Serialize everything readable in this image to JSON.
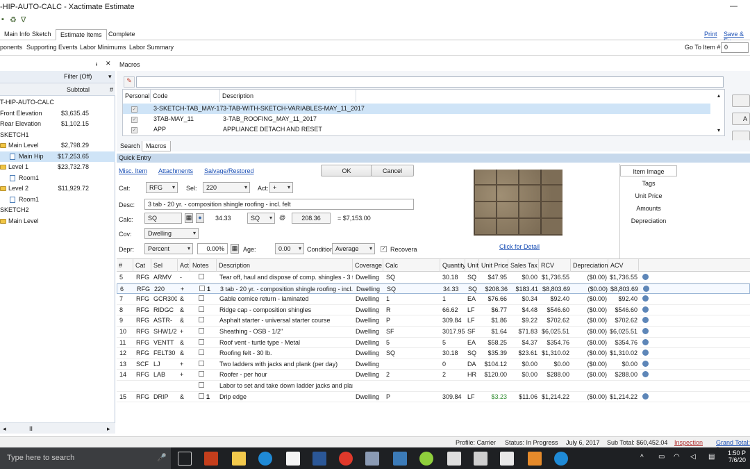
{
  "window": {
    "title": "-HIP-AUTO-CALC - Xactimate Estimate"
  },
  "tabs": [
    {
      "label": "Main Info"
    },
    {
      "label": "Sketch"
    },
    {
      "label": "Estimate Items"
    },
    {
      "label": "Complete"
    }
  ],
  "top_links": {
    "print": "Print",
    "save_exit": "Save & Ex"
  },
  "subribbon": {
    "items": [
      "ponents",
      "Supporting Events",
      "Labor Minimums",
      "Labor Summary"
    ],
    "goto_label": "Go To Item #:",
    "goto_value": "0"
  },
  "left_panel": {
    "filter": "Filter (Off)",
    "subtotal_header": "Subtotal",
    "hash_header": "#",
    "tree": [
      {
        "label": "T-HIP-AUTO-CALC",
        "value": ""
      },
      {
        "label": "Front Elevation",
        "value": "$3,635.45"
      },
      {
        "label": "Rear Elevation",
        "value": "$1,102.15"
      },
      {
        "label": "SKETCH1",
        "value": ""
      },
      {
        "label": "Main Level",
        "value": "$2,798.29"
      },
      {
        "label": "Main Hip",
        "value": "$17,253.65"
      },
      {
        "label": "Level 1",
        "value": "$23,732.78"
      },
      {
        "label": "Room1",
        "value": ""
      },
      {
        "label": "Level 2",
        "value": "$11,929.72"
      },
      {
        "label": "Room1",
        "value": ""
      },
      {
        "label": "SKETCH2",
        "value": ""
      },
      {
        "label": "Main Level",
        "value": ""
      }
    ],
    "scroll_label": "II"
  },
  "macros": {
    "title": "Macros",
    "columns": [
      "Personal",
      "Code",
      "Description"
    ],
    "rows": [
      {
        "code": "3-SKETCH-TAB_MAY-17",
        "description": "3-TAB-WITH-SKETCH-VARIABLES-MAY_11_2017"
      },
      {
        "code": "3TAB-MAY_11",
        "description": "3-TAB_ROOFING_MAY_11_2017"
      },
      {
        "code": "APP",
        "description": "APPLIANCE DETACH AND RESET"
      }
    ],
    "tabs": [
      "Search",
      "Macros"
    ],
    "side_buttons": [
      "A"
    ]
  },
  "quick_entry": {
    "bar_label": "Quick Entry",
    "links": {
      "misc": "Misc. Item",
      "attachments": "Attachments",
      "salvage": "Salvage/Restored"
    },
    "ok": "OK",
    "cancel": "Cancel",
    "cat_label": "Cat:",
    "cat_value": "RFG",
    "sel_label": "Sel:",
    "sel_value": "220",
    "act_label": "Act:",
    "act_value": "+",
    "desc_label": "Desc:",
    "desc_value": "3 tab - 20 yr. - composition shingle roofing - incl. felt",
    "calc_label": "Calc:",
    "calc_value": "SQ",
    "calc_qty": "34.33",
    "unit_value": "SQ",
    "at": "@",
    "unit_price": "208.36",
    "total": "= $7,153.00",
    "cov_label": "Cov:",
    "cov_value": "Dwelling",
    "depr_label": "Depr:",
    "depr_value": "Percent",
    "depr_pct": "0.00%",
    "age_label": "Age:",
    "age_value": "0.00",
    "condition_label": "Condition:",
    "condition_value": "Average",
    "recoverable_label": "Recovera",
    "detail_link": "Click for Detail",
    "side_tabs": [
      "Item Image",
      "Tags",
      "Unit Price",
      "Amounts",
      "Depreciation"
    ]
  },
  "grid": {
    "columns": [
      "#",
      "Cat",
      "Sel",
      "Act",
      "Notes",
      "Description",
      "Coverage",
      "Calc",
      "Quantity",
      "Unit",
      "Unit Price",
      "Sales Tax",
      "RCV",
      "Depreciation",
      "ACV"
    ],
    "rows": [
      {
        "n": "5",
        "cat": "RFG",
        "sel": "ARMV",
        "act": "-",
        "note": "",
        "desc": "Tear off, haul and dispose of comp. shingles - 3 tab",
        "cov": "Dwelling",
        "calc": "SQ",
        "qty": "30.18",
        "unit": "SQ",
        "price": "$47.95",
        "tax": "$0.00",
        "rcv": "$1,736.55",
        "dep": "($0.00)",
        "acv": "$1,736.55"
      },
      {
        "n": "6",
        "cat": "RFG",
        "sel": "220",
        "act": "+",
        "note": "1",
        "desc": "3 tab - 20 yr. - composition shingle roofing - incl. felt",
        "cov": "Dwelling",
        "calc": "SQ",
        "qty": "34.33",
        "unit": "SQ",
        "price": "$208.36",
        "tax": "$183.41",
        "rcv": "$8,803.69",
        "dep": "($0.00)",
        "acv": "$8,803.69"
      },
      {
        "n": "7",
        "cat": "RFG",
        "sel": "GCR300",
        "act": "&",
        "note": "",
        "desc": "Gable cornice return - laminated",
        "cov": "Dwelling",
        "calc": "1",
        "qty": "1",
        "unit": "EA",
        "price": "$76.66",
        "tax": "$0.34",
        "rcv": "$92.40",
        "dep": "($0.00)",
        "acv": "$92.40"
      },
      {
        "n": "8",
        "cat": "RFG",
        "sel": "RIDGC",
        "act": "&",
        "note": "",
        "desc": "Ridge cap - composition shingles",
        "cov": "Dwelling",
        "calc": "R",
        "qty": "66.62",
        "unit": "LF",
        "price": "$6.77",
        "tax": "$4.48",
        "rcv": "$546.60",
        "dep": "($0.00)",
        "acv": "$546.60"
      },
      {
        "n": "9",
        "cat": "RFG",
        "sel": "ASTR-",
        "act": "&",
        "note": "",
        "desc": "Asphalt starter - universal starter course",
        "cov": "Dwelling",
        "calc": "P",
        "qty": "309.84",
        "unit": "LF",
        "price": "$1.86",
        "tax": "$9.22",
        "rcv": "$702.62",
        "dep": "($0.00)",
        "acv": "$702.62"
      },
      {
        "n": "10",
        "cat": "RFG",
        "sel": "SHW1/2",
        "act": "+",
        "note": "",
        "desc": "Sheathing - OSB - 1/2\"",
        "cov": "Dwelling",
        "calc": "SF",
        "qty": "3017.95",
        "unit": "SF",
        "price": "$1.64",
        "tax": "$71.83",
        "rcv": "$6,025.51",
        "dep": "($0.00)",
        "acv": "$6,025.51"
      },
      {
        "n": "11",
        "cat": "RFG",
        "sel": "VENTT",
        "act": "&",
        "note": "",
        "desc": "Roof vent - turtle type - Metal",
        "cov": "Dwelling",
        "calc": "5",
        "qty": "5",
        "unit": "EA",
        "price": "$58.25",
        "tax": "$4.37",
        "rcv": "$354.76",
        "dep": "($0.00)",
        "acv": "$354.76"
      },
      {
        "n": "12",
        "cat": "RFG",
        "sel": "FELT30",
        "act": "&",
        "note": "",
        "desc": "Roofing felt - 30 lb.",
        "cov": "Dwelling",
        "calc": "SQ",
        "qty": "30.18",
        "unit": "SQ",
        "price": "$35.39",
        "tax": "$23.61",
        "rcv": "$1,310.02",
        "dep": "($0.00)",
        "acv": "$1,310.02"
      },
      {
        "n": "13",
        "cat": "SCF",
        "sel": "LJ",
        "act": "+",
        "note": "",
        "desc": "Two ladders with jacks and plank (per day)",
        "cov": "Dwelling",
        "calc": "",
        "qty": "0",
        "unit": "DA",
        "price": "$104.12",
        "tax": "$0.00",
        "rcv": "$0.00",
        "dep": "($0.00)",
        "acv": "$0.00"
      },
      {
        "n": "14",
        "cat": "RFG",
        "sel": "LAB",
        "act": "+",
        "note": "",
        "desc": "Roofer - per hour",
        "cov": "Dwelling",
        "calc": "2",
        "qty": "2",
        "unit": "HR",
        "price": "$120.00",
        "tax": "$0.00",
        "rcv": "$288.00",
        "dep": "($0.00)",
        "acv": "$288.00"
      },
      {
        "n": "",
        "cat": "",
        "sel": "",
        "act": "",
        "note": "",
        "desc": "Labor to set and take down ladder jacks and plank",
        "cov": "",
        "calc": "",
        "qty": "",
        "unit": "",
        "price": "",
        "tax": "",
        "rcv": "",
        "dep": "",
        "acv": ""
      },
      {
        "n": "15",
        "cat": "RFG",
        "sel": "DRIP",
        "act": "&",
        "note": "1",
        "desc": "Drip edge",
        "cov": "Dwelling",
        "calc": "P",
        "qty": "309.84",
        "unit": "LF",
        "price": "$3.23",
        "tax": "$11.06",
        "rcv": "$1,214.22",
        "dep": "($0.00)",
        "acv": "$1,214.22"
      }
    ]
  },
  "status": {
    "profile": "Profile: Carrier",
    "status": "Status: In Progress",
    "date": "July 6, 2017",
    "subtotal": "Sub Total: $60,452.04",
    "inspection": "Inspection",
    "grand_total": "Grand Total: $"
  },
  "taskbar": {
    "search_placeholder": "Type here to search",
    "time": "1:50 P",
    "date": "7/6/20"
  },
  "colors": {
    "accent": "#1a4fb5",
    "selection": "#cfe4f7",
    "quick_entry_bar": "#c7d9ec",
    "green_price": "#2e8b2e"
  }
}
